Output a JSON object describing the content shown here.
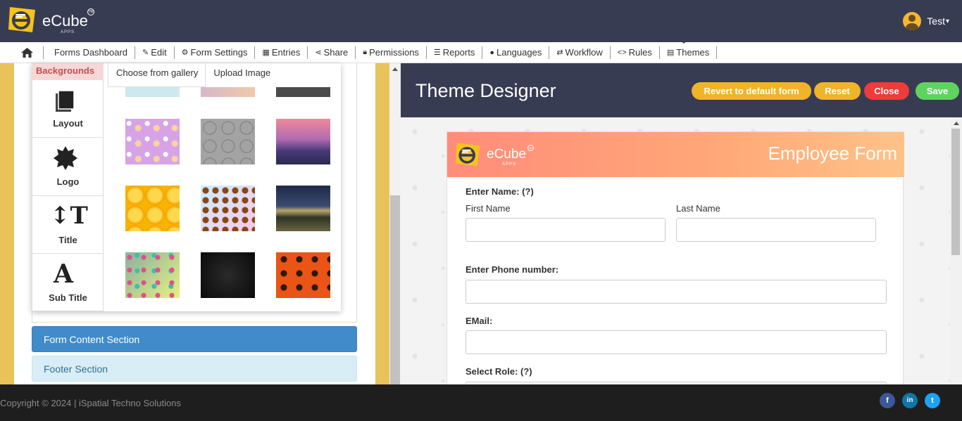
{
  "header": {
    "brand": "eCube",
    "brand_sub": "APPS",
    "brand_tm": "TM",
    "user_name": "Test",
    "user_caret": "▾"
  },
  "nav": {
    "items": [
      {
        "label": "Forms Dashboard",
        "icon": ""
      },
      {
        "label": "Edit",
        "icon": "edit-icon"
      },
      {
        "label": "Form Settings",
        "icon": "gear-icon"
      },
      {
        "label": "Entries",
        "icon": "table-icon"
      },
      {
        "label": "Share",
        "icon": "share-icon"
      },
      {
        "label": "Permissions",
        "icon": "lock-icon"
      },
      {
        "label": "Reports",
        "icon": "database-icon"
      },
      {
        "label": "Languages",
        "icon": "globe-icon"
      },
      {
        "label": "Workflow",
        "icon": "retweet-icon"
      },
      {
        "label": "Rules",
        "icon": "code-icon"
      },
      {
        "label": "Themes",
        "icon": "newspaper-icon"
      }
    ]
  },
  "left": {
    "backgrounds_label": "Backgrounds",
    "tabs": [
      "Layout",
      "Logo",
      "Title",
      "Sub Title"
    ],
    "gallery_tabs": [
      "Choose from gallery",
      "Upload Image"
    ],
    "sections": [
      "Form Content Section",
      "Footer Section"
    ]
  },
  "designer": {
    "title": "Theme Designer",
    "buttons": {
      "revert": "Revert to default form",
      "reset": "Reset",
      "close": "Close",
      "save": "Save"
    }
  },
  "form": {
    "title": "Employee Form",
    "brand": "eCube",
    "brand_sub": "APPS",
    "brand_tm": "TM",
    "enter_name": "Enter Name: (?)",
    "first_name": "First Name",
    "last_name": "Last Name",
    "phone": "Enter Phone number:",
    "email": "EMail:",
    "role": "Select Role: (?)"
  },
  "footer": {
    "copyright": "Copyright © 2024 | iSpatial Techno Solutions",
    "social": [
      "f",
      "in",
      "t"
    ]
  },
  "colors": {
    "header_bg": "#383c53",
    "accent_yellow": "#f0b429",
    "close_red": "#ef3b3b",
    "save_green": "#5fd35f",
    "section_blue": "#428bca"
  }
}
